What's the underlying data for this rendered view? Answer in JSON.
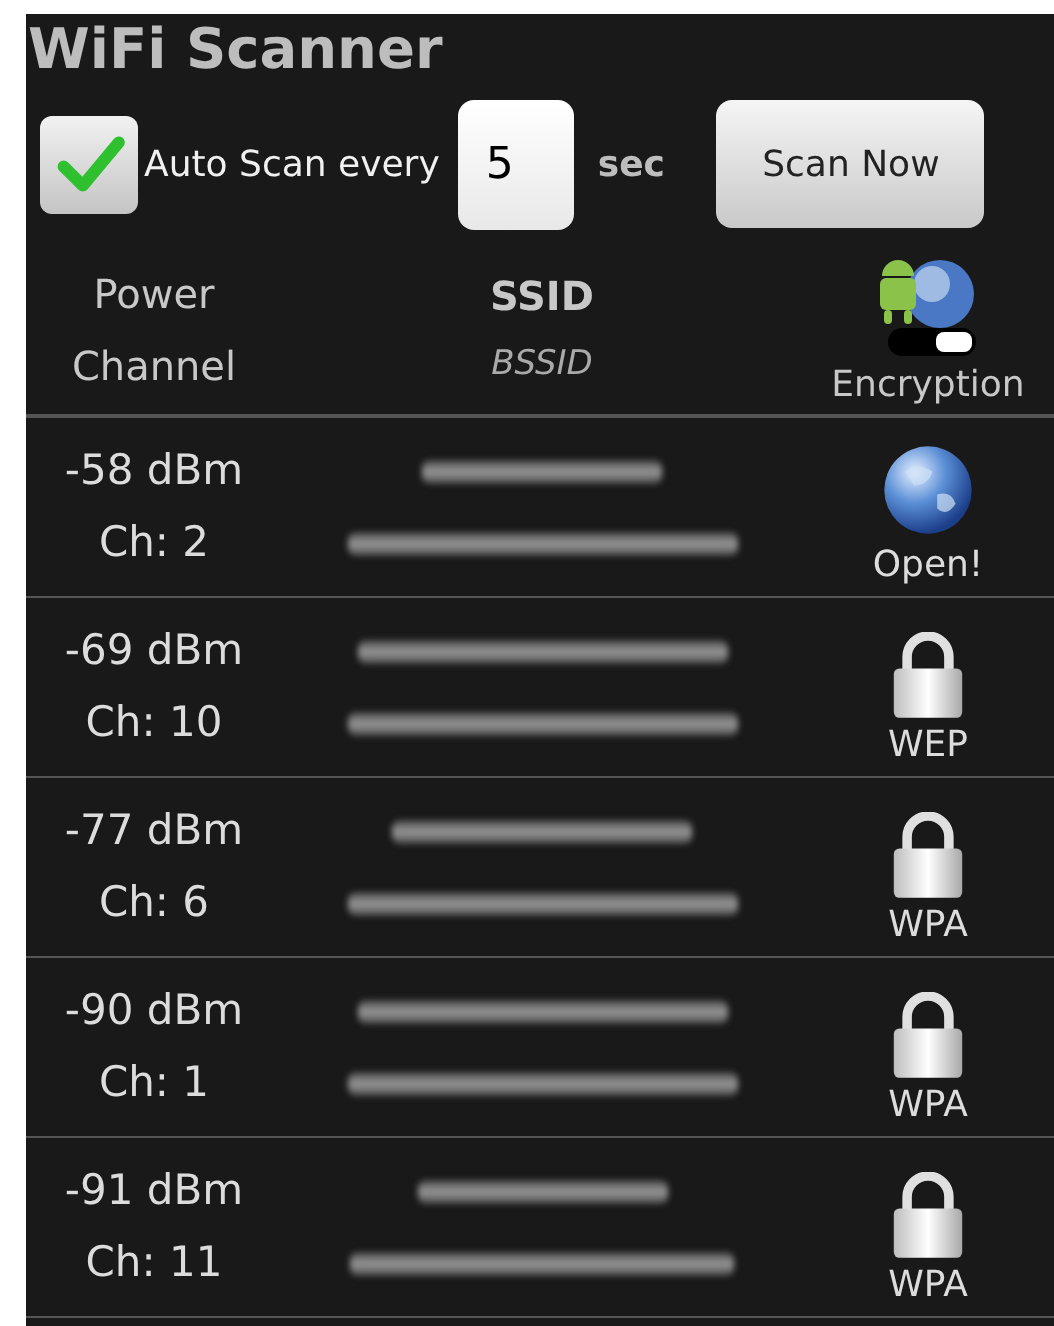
{
  "title": "WiFi Scanner",
  "controls": {
    "auto_scan": {
      "label": "Auto Scan every",
      "checked": true
    },
    "interval": {
      "value": "5"
    },
    "unit": "sec",
    "scan_button": "Scan Now"
  },
  "header": {
    "power": "Power",
    "channel": "Channel",
    "ssid": "SSID",
    "bssid": "BSSID",
    "encryption": "Encryption"
  },
  "networks": [
    {
      "power": "-58 dBm",
      "channel": "Ch: 2",
      "kind": "open",
      "encryption": "Open!"
    },
    {
      "power": "-69 dBm",
      "channel": "Ch: 10",
      "kind": "locked",
      "encryption": "WEP"
    },
    {
      "power": "-77 dBm",
      "channel": "Ch: 6",
      "kind": "locked",
      "encryption": "WPA"
    },
    {
      "power": "-90 dBm",
      "channel": "Ch: 1",
      "kind": "locked",
      "encryption": "WPA"
    },
    {
      "power": "-91 dBm",
      "channel": "Ch: 11",
      "kind": "locked",
      "encryption": "WPA"
    }
  ]
}
